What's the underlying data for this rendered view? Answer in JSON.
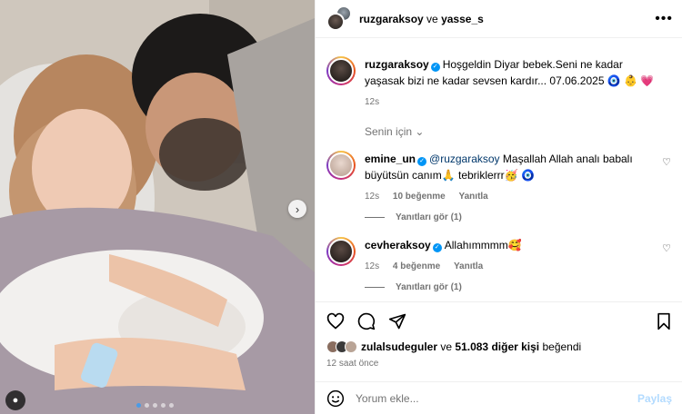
{
  "header": {
    "user1": "ruzgaraksoy",
    "connector": "ve",
    "user2": "yasse_s",
    "more_icon": "more-horizontal-icon"
  },
  "caption": {
    "username": "ruzgaraksoy",
    "text": "Hoşgeldin Diyar bebek.Seni ne kadar yaşasak bizi ne kadar sevsen kardır... 07.06.2025 🧿 👶 💗",
    "time": "12s"
  },
  "for_you_label": "Senin için ⌄",
  "comments": [
    {
      "username": "emine_un",
      "mention": "@ruzgaraksoy",
      "text": " Maşallah Allah analı babalı büyütsün canım🙏 tebriklerrr🥳 🧿",
      "time": "12s",
      "likes": "10 beğenme",
      "reply": "Yanıtla",
      "view_replies": "Yanıtları gör (1)"
    },
    {
      "username": "cevheraksoy",
      "mention": "",
      "text": "Allahımmmm🥰",
      "time": "12s",
      "likes": "4 beğenme",
      "reply": "Yanıtla",
      "view_replies": "Yanıtları gör (1)"
    }
  ],
  "actions": {
    "liked_by_user": "zulalsudeguler",
    "liked_connector": "ve",
    "liked_others": "51.083 diğer kişi",
    "liked_suffix": "beğendi",
    "post_time": "12 saat önce"
  },
  "add_comment": {
    "placeholder": "Yorum ekle...",
    "post_label": "Paylaş",
    "emoji_icon": "emoji-icon"
  },
  "colors": {
    "accent": "#0095f6",
    "muted": "#737373",
    "link": "#00376b"
  }
}
